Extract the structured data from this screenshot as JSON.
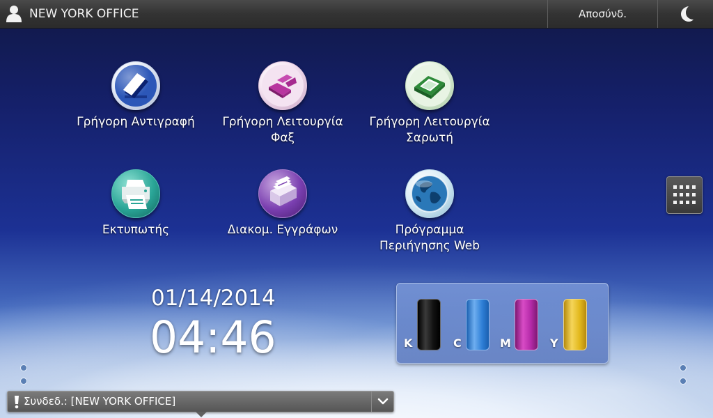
{
  "header": {
    "title": "NEW YORK OFFICE",
    "logout_label": "Αποσύνδ."
  },
  "apps": [
    {
      "label": "Γρήγορη Αντιγραφή",
      "icon": "quick-copy-icon"
    },
    {
      "label": "Γρήγορη Λειτουργία Φαξ",
      "icon": "quick-fax-icon"
    },
    {
      "label": "Γρήγορη Λειτουργία Σαρωτή",
      "icon": "quick-scanner-icon"
    },
    {
      "label": "Εκτυπωτής",
      "icon": "printer-icon"
    },
    {
      "label": "Διακομ. Εγγράφων",
      "icon": "document-server-icon"
    },
    {
      "label": "Πρόγραμμα Περιήγησης Web",
      "icon": "web-browser-icon"
    }
  ],
  "clock": {
    "date": "01/14/2014",
    "time": "04:46"
  },
  "toner": [
    {
      "letter": "K",
      "color": "#1a1a1a"
    },
    {
      "letter": "C",
      "color": "#2f7fd6"
    },
    {
      "letter": "M",
      "color": "#b42aa8"
    },
    {
      "letter": "Y",
      "color": "#e2b81c"
    }
  ],
  "status": {
    "text": "Συνδεδ.: [NEW YORK OFFICE]"
  }
}
